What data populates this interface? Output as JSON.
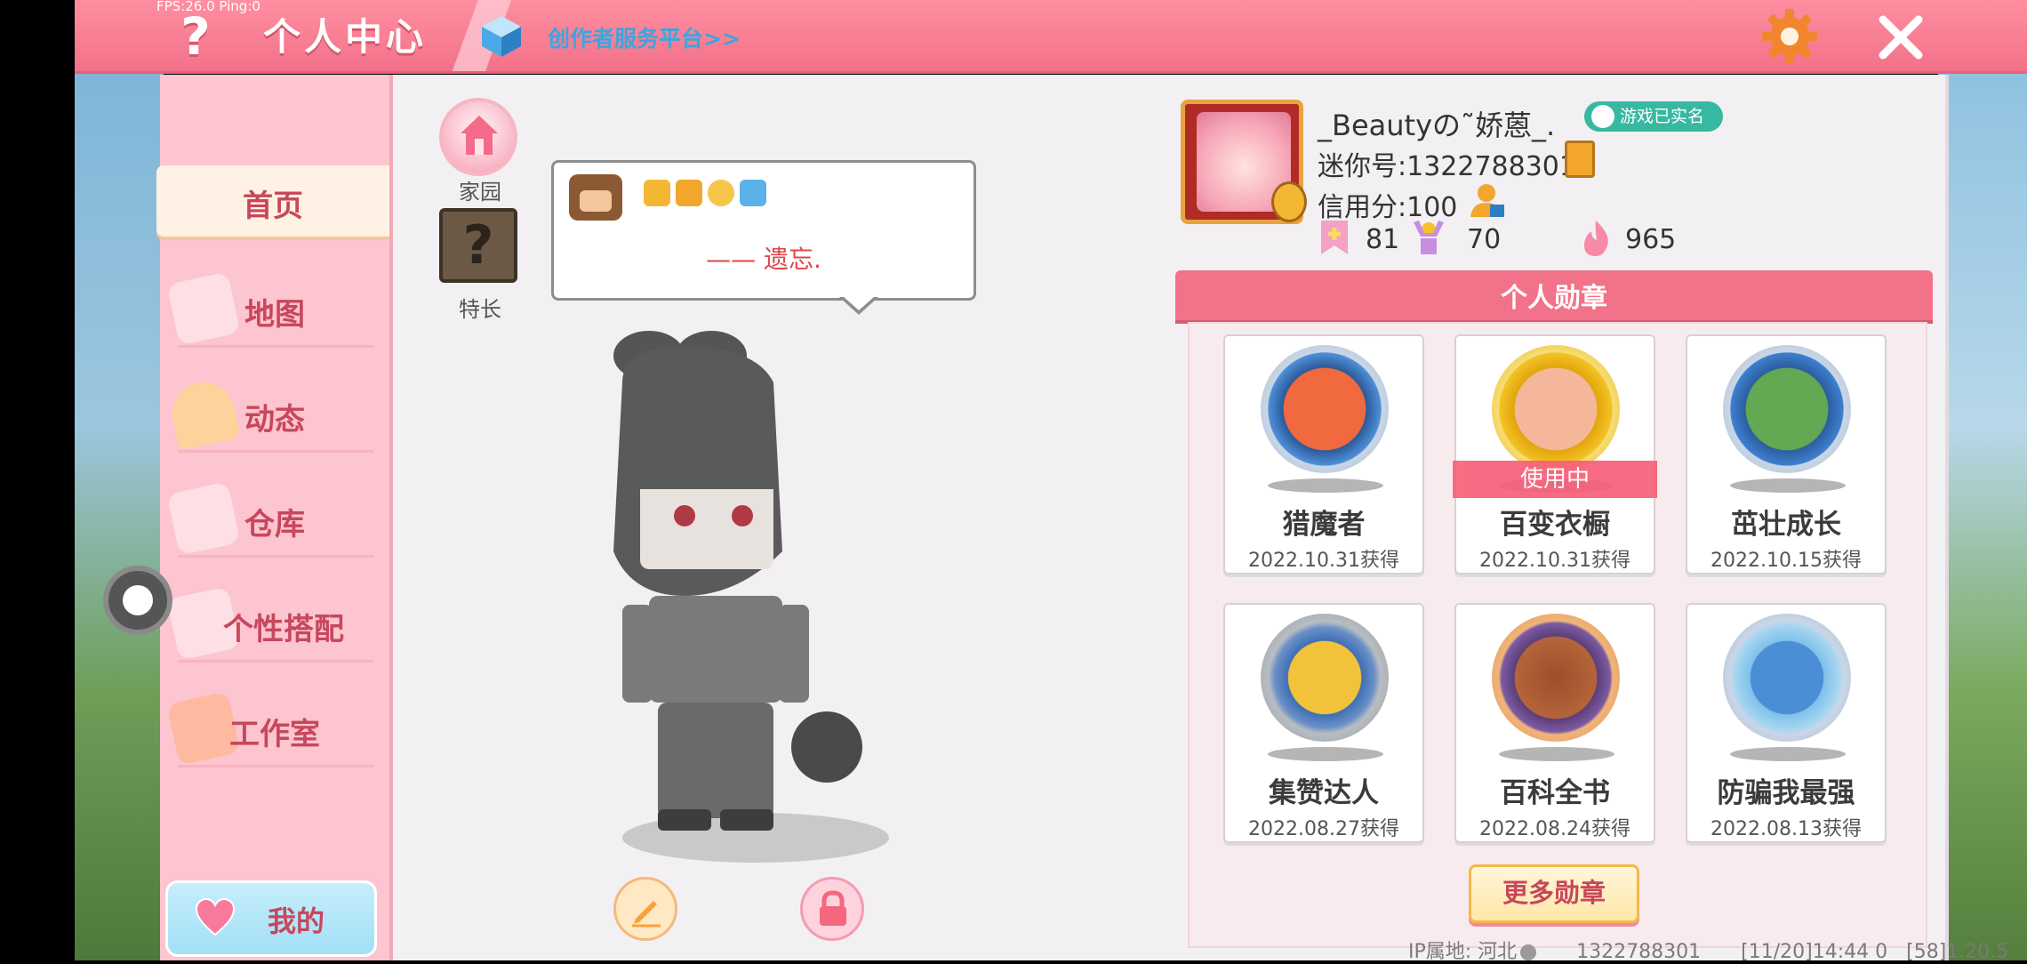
{
  "status": {
    "fps": "FPS:26.0 Ping:0"
  },
  "header": {
    "title": "个人中心",
    "creator_link": "创作者服务平台>>",
    "help_icon": "question-icon",
    "settings_icon": "gear-icon",
    "close_icon": "close-icon"
  },
  "sidebar": {
    "items": [
      {
        "label": "首页",
        "icon": "home-icon",
        "active": true
      },
      {
        "label": "地图",
        "icon": "map-icon"
      },
      {
        "label": "动态",
        "icon": "bell-icon"
      },
      {
        "label": "仓库",
        "icon": "warehouse-icon"
      },
      {
        "label": "个性搭配",
        "icon": "outfit-icon"
      },
      {
        "label": "工作室",
        "icon": "studio-icon"
      }
    ],
    "mine_label": "我的"
  },
  "quick": {
    "home": "家园",
    "talent": "特长",
    "talent_glyph": "?"
  },
  "bubble": {
    "signature": "—— 遗忘."
  },
  "profile": {
    "username": "_Beautyの˜娇蒽_.",
    "realname_badge": "游戏已实名",
    "mini_id": "迷你号:1322788301",
    "credit": "信用分:100",
    "stats": [
      "81",
      "70",
      "965"
    ]
  },
  "medals": {
    "title": "个人勋章",
    "in_use_label": "使用中",
    "items": [
      {
        "name": "猎魔者",
        "date": "2022.10.31获得",
        "color": "#4f8fd8"
      },
      {
        "name": "百变衣橱",
        "date": "2022.10.31获得",
        "color": "#f3c327",
        "in_use": true
      },
      {
        "name": "茁壮成长",
        "date": "2022.10.15获得",
        "color": "#3e7fd0"
      },
      {
        "name": "集赞达人",
        "date": "2022.08.27获得",
        "color": "#9aa1a8"
      },
      {
        "name": "百科全书",
        "date": "2022.08.24获得",
        "color": "#d98f4e"
      },
      {
        "name": "防骗我最强",
        "date": "2022.08.13获得",
        "color": "#4a8fd6"
      }
    ],
    "more_label": "更多勋章"
  },
  "footer": {
    "ip": "IP属地: 河北",
    "id": "1322788301",
    "time": "[11/20]14:44 0",
    "version": "[58]1.20.5"
  },
  "colors": {
    "accent": "#f27289",
    "sidebar": "#fcc5cf",
    "nav_text": "#c7475c",
    "link": "#3aa6df"
  }
}
